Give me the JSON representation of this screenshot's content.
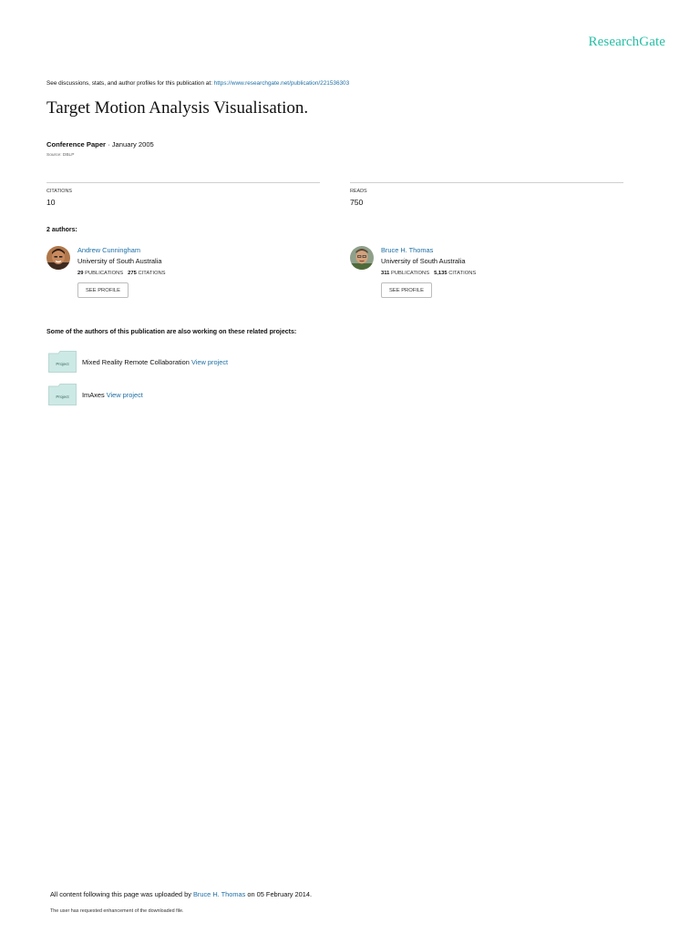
{
  "brand": {
    "logo": "ResearchGate",
    "color": "#26bfa5"
  },
  "header": {
    "discuss_text": "See discussions, stats, and author profiles for this publication at: ",
    "discuss_link": "https://www.researchgate.net/publication/221536303"
  },
  "publication": {
    "title": "Target Motion Analysis Visualisation.",
    "type": "Conference Paper",
    "separator": " · ",
    "date": "January 2005",
    "source": "Source: DBLP"
  },
  "stats": {
    "citations": {
      "label": "CITATIONS",
      "value": "10"
    },
    "reads": {
      "label": "READS",
      "value": "750"
    }
  },
  "authors_heading": "2 authors:",
  "authors": [
    {
      "name": "Andrew Cunningham",
      "institution": "University of South Australia",
      "publications": "29",
      "publications_label": "PUBLICATIONS",
      "citations": "275",
      "citations_label": "CITATIONS",
      "button": "SEE PROFILE"
    },
    {
      "name": "Bruce H. Thomas",
      "institution": "University of South Australia",
      "publications": "311",
      "publications_label": "PUBLICATIONS",
      "citations": "5,135",
      "citations_label": "CITATIONS",
      "button": "SEE PROFILE"
    }
  ],
  "projects_heading": "Some of the authors of this publication are also working on these related projects:",
  "projects": [
    {
      "icon_label": "Project",
      "name": "Mixed Reality Remote Collaboration",
      "link": "View project"
    },
    {
      "icon_label": "Project",
      "name": "ImAxes",
      "link": "View project"
    }
  ],
  "footer": {
    "prefix": "All content following this page was uploaded by ",
    "uploader": "Bruce H. Thomas",
    "suffix": " on 05 February 2014.",
    "note": "The user has requested enhancement of the downloaded file."
  },
  "colors": {
    "link": "#1d6fa5",
    "divider": "#cfcfcf",
    "project_icon": "#cde9e5"
  }
}
